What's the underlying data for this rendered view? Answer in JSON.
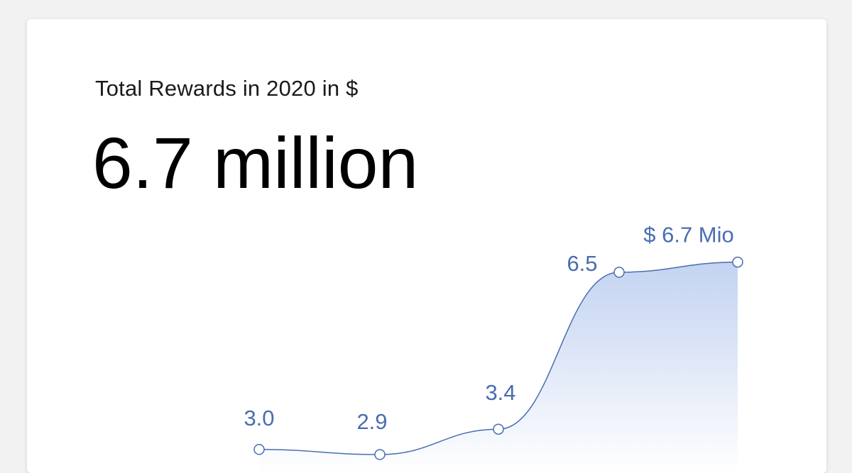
{
  "card": {
    "title": "Total Rewards in 2020 in $",
    "headline": "6.7 million"
  },
  "colors": {
    "line": "#4a6db0",
    "label": "#4a6db0",
    "fill_top": "#c3d3f1",
    "fill_bottom": "#ffffff",
    "marker_fill": "#ffffff"
  },
  "chart_data": {
    "type": "area",
    "values": [
      3.0,
      2.9,
      3.4,
      6.5,
      6.7
    ],
    "data_labels": [
      "3.0",
      "2.9",
      "3.4",
      "6.5",
      "$ 6.7 Mio"
    ],
    "title": "Total Rewards in 2020 in $",
    "xlabel": "",
    "ylabel": "",
    "grid": false,
    "legend": "none",
    "markers": "hollow-circle"
  }
}
